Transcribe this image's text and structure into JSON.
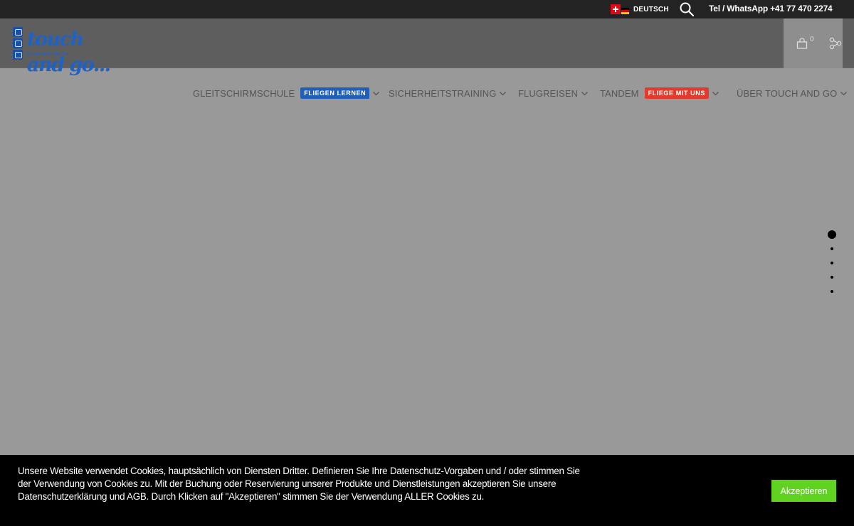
{
  "topbar": {
    "language_label": "DEUTSCH",
    "phone": "Tel / WhatsApp +41 77 470 2274",
    "icons": [
      "swiss-flag-icon",
      "german-flag-icon",
      "search-icon"
    ]
  },
  "header": {
    "logo_text": "touch and go...",
    "logo_sub": "PARAGLIDING.CH",
    "cart_count": "0",
    "icons": [
      "cart-icon",
      "share-icon"
    ]
  },
  "nav": {
    "items": [
      {
        "label": "GLEITSCHIRMSCHULE",
        "badge": "FLIEGEN LERNEN",
        "badge_color": "#1f5fb8"
      },
      {
        "label": "SICHERHEITSTRAINING"
      },
      {
        "label": "FLUGREISEN"
      },
      {
        "label": "TANDEM",
        "badge": "FLIEGE MIT UNS",
        "badge_color": "#e23b2e"
      },
      {
        "label": "ÜBER TOUCH AND GO"
      }
    ]
  },
  "slider": {
    "dot_count": 5,
    "active_index": 0
  },
  "cookie": {
    "text": "Unsere Website verwendet Cookies, hauptsächlich von Diensten Dritter. Definieren Sie Ihre Datenschutz-Vorgaben und / oder stimmen Sie der Verwendung von Cookies zu. Mit der Buchung oder Reservierung unserer Produkte und Dienstleistungen akzeptieren Sie unsere Datenschutzerklärung und AGB. Durch Klicken auf \"Akzeptieren\" stimmen Sie der Verwendung ALLER Cookies zu.",
    "accept_label": "Akzeptieren",
    "accept_color": "#5fd31f"
  },
  "colors": {
    "topbar": "#232323",
    "header": "#5e5e5e",
    "page": "#999999",
    "logo": "#1f62c4"
  }
}
